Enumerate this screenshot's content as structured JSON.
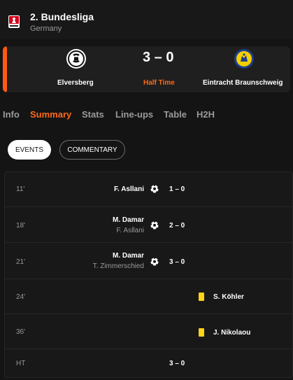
{
  "league": {
    "name": "2. Bundesliga",
    "country": "Germany",
    "logo_text": "2. BUNDESLIGA"
  },
  "match": {
    "home_team": "Elversberg",
    "away_team": "Eintracht Braunschweig",
    "score": "3 – 0",
    "status": "Half Time",
    "accent_color": "#ff5a14"
  },
  "tabs": [
    {
      "label": "Info"
    },
    {
      "label": "Summary"
    },
    {
      "label": "Stats"
    },
    {
      "label": "Line-ups"
    },
    {
      "label": "Table"
    },
    {
      "label": "H2H"
    }
  ],
  "subtabs": {
    "events": "EVENTS",
    "commentary": "COMMENTARY"
  },
  "events": [
    {
      "minute": "11'",
      "player": "F. Asllani",
      "score": "1 – 0",
      "icon": "ball-icon"
    },
    {
      "minute": "18'",
      "player": "M. Damar",
      "assist": "F. Asllani",
      "score": "2 – 0",
      "icon": "ball-icon"
    },
    {
      "minute": "21'",
      "player": "M. Damar",
      "assist": "T. Zimmerschied",
      "score": "3 – 0",
      "icon": "ball-icon"
    },
    {
      "minute": "24'",
      "player": "S. Köhler",
      "icon": "yellow-card-icon"
    },
    {
      "minute": "36'",
      "player": "J. Nikolaou",
      "icon": "yellow-card-icon"
    },
    {
      "minute": "HT",
      "score": "3 – 0"
    }
  ]
}
